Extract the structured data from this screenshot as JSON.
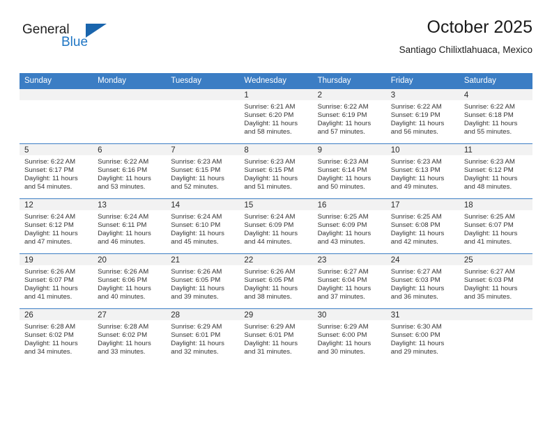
{
  "logo": {
    "word1": "General",
    "word2": "Blue",
    "triangle_icon": "triangle-icon",
    "brand_color": "#1f76c4"
  },
  "header": {
    "title": "October 2025",
    "subtitle": "Santiago Chilixtlahuaca, Mexico"
  },
  "theme": {
    "header_bg": "#3b7dc4",
    "daynum_bg": "#f2f2f2",
    "text": "#333333"
  },
  "calendar": {
    "weekday_headers": [
      "Sunday",
      "Monday",
      "Tuesday",
      "Wednesday",
      "Thursday",
      "Friday",
      "Saturday"
    ],
    "weeks": [
      [
        {
          "day": "",
          "empty": true
        },
        {
          "day": "",
          "empty": true
        },
        {
          "day": "",
          "empty": true
        },
        {
          "day": "1",
          "sunrise": "Sunrise: 6:21 AM",
          "sunset": "Sunset: 6:20 PM",
          "daylight": "Daylight: 11 hours and 58 minutes."
        },
        {
          "day": "2",
          "sunrise": "Sunrise: 6:22 AM",
          "sunset": "Sunset: 6:19 PM",
          "daylight": "Daylight: 11 hours and 57 minutes."
        },
        {
          "day": "3",
          "sunrise": "Sunrise: 6:22 AM",
          "sunset": "Sunset: 6:19 PM",
          "daylight": "Daylight: 11 hours and 56 minutes."
        },
        {
          "day": "4",
          "sunrise": "Sunrise: 6:22 AM",
          "sunset": "Sunset: 6:18 PM",
          "daylight": "Daylight: 11 hours and 55 minutes."
        }
      ],
      [
        {
          "day": "5",
          "sunrise": "Sunrise: 6:22 AM",
          "sunset": "Sunset: 6:17 PM",
          "daylight": "Daylight: 11 hours and 54 minutes."
        },
        {
          "day": "6",
          "sunrise": "Sunrise: 6:22 AM",
          "sunset": "Sunset: 6:16 PM",
          "daylight": "Daylight: 11 hours and 53 minutes."
        },
        {
          "day": "7",
          "sunrise": "Sunrise: 6:23 AM",
          "sunset": "Sunset: 6:15 PM",
          "daylight": "Daylight: 11 hours and 52 minutes."
        },
        {
          "day": "8",
          "sunrise": "Sunrise: 6:23 AM",
          "sunset": "Sunset: 6:15 PM",
          "daylight": "Daylight: 11 hours and 51 minutes."
        },
        {
          "day": "9",
          "sunrise": "Sunrise: 6:23 AM",
          "sunset": "Sunset: 6:14 PM",
          "daylight": "Daylight: 11 hours and 50 minutes."
        },
        {
          "day": "10",
          "sunrise": "Sunrise: 6:23 AM",
          "sunset": "Sunset: 6:13 PM",
          "daylight": "Daylight: 11 hours and 49 minutes."
        },
        {
          "day": "11",
          "sunrise": "Sunrise: 6:23 AM",
          "sunset": "Sunset: 6:12 PM",
          "daylight": "Daylight: 11 hours and 48 minutes."
        }
      ],
      [
        {
          "day": "12",
          "sunrise": "Sunrise: 6:24 AM",
          "sunset": "Sunset: 6:12 PM",
          "daylight": "Daylight: 11 hours and 47 minutes."
        },
        {
          "day": "13",
          "sunrise": "Sunrise: 6:24 AM",
          "sunset": "Sunset: 6:11 PM",
          "daylight": "Daylight: 11 hours and 46 minutes."
        },
        {
          "day": "14",
          "sunrise": "Sunrise: 6:24 AM",
          "sunset": "Sunset: 6:10 PM",
          "daylight": "Daylight: 11 hours and 45 minutes."
        },
        {
          "day": "15",
          "sunrise": "Sunrise: 6:24 AM",
          "sunset": "Sunset: 6:09 PM",
          "daylight": "Daylight: 11 hours and 44 minutes."
        },
        {
          "day": "16",
          "sunrise": "Sunrise: 6:25 AM",
          "sunset": "Sunset: 6:09 PM",
          "daylight": "Daylight: 11 hours and 43 minutes."
        },
        {
          "day": "17",
          "sunrise": "Sunrise: 6:25 AM",
          "sunset": "Sunset: 6:08 PM",
          "daylight": "Daylight: 11 hours and 42 minutes."
        },
        {
          "day": "18",
          "sunrise": "Sunrise: 6:25 AM",
          "sunset": "Sunset: 6:07 PM",
          "daylight": "Daylight: 11 hours and 41 minutes."
        }
      ],
      [
        {
          "day": "19",
          "sunrise": "Sunrise: 6:26 AM",
          "sunset": "Sunset: 6:07 PM",
          "daylight": "Daylight: 11 hours and 41 minutes."
        },
        {
          "day": "20",
          "sunrise": "Sunrise: 6:26 AM",
          "sunset": "Sunset: 6:06 PM",
          "daylight": "Daylight: 11 hours and 40 minutes."
        },
        {
          "day": "21",
          "sunrise": "Sunrise: 6:26 AM",
          "sunset": "Sunset: 6:05 PM",
          "daylight": "Daylight: 11 hours and 39 minutes."
        },
        {
          "day": "22",
          "sunrise": "Sunrise: 6:26 AM",
          "sunset": "Sunset: 6:05 PM",
          "daylight": "Daylight: 11 hours and 38 minutes."
        },
        {
          "day": "23",
          "sunrise": "Sunrise: 6:27 AM",
          "sunset": "Sunset: 6:04 PM",
          "daylight": "Daylight: 11 hours and 37 minutes."
        },
        {
          "day": "24",
          "sunrise": "Sunrise: 6:27 AM",
          "sunset": "Sunset: 6:03 PM",
          "daylight": "Daylight: 11 hours and 36 minutes."
        },
        {
          "day": "25",
          "sunrise": "Sunrise: 6:27 AM",
          "sunset": "Sunset: 6:03 PM",
          "daylight": "Daylight: 11 hours and 35 minutes."
        }
      ],
      [
        {
          "day": "26",
          "sunrise": "Sunrise: 6:28 AM",
          "sunset": "Sunset: 6:02 PM",
          "daylight": "Daylight: 11 hours and 34 minutes."
        },
        {
          "day": "27",
          "sunrise": "Sunrise: 6:28 AM",
          "sunset": "Sunset: 6:02 PM",
          "daylight": "Daylight: 11 hours and 33 minutes."
        },
        {
          "day": "28",
          "sunrise": "Sunrise: 6:29 AM",
          "sunset": "Sunset: 6:01 PM",
          "daylight": "Daylight: 11 hours and 32 minutes."
        },
        {
          "day": "29",
          "sunrise": "Sunrise: 6:29 AM",
          "sunset": "Sunset: 6:01 PM",
          "daylight": "Daylight: 11 hours and 31 minutes."
        },
        {
          "day": "30",
          "sunrise": "Sunrise: 6:29 AM",
          "sunset": "Sunset: 6:00 PM",
          "daylight": "Daylight: 11 hours and 30 minutes."
        },
        {
          "day": "31",
          "sunrise": "Sunrise: 6:30 AM",
          "sunset": "Sunset: 6:00 PM",
          "daylight": "Daylight: 11 hours and 29 minutes."
        },
        {
          "day": "",
          "empty": true
        }
      ]
    ]
  }
}
